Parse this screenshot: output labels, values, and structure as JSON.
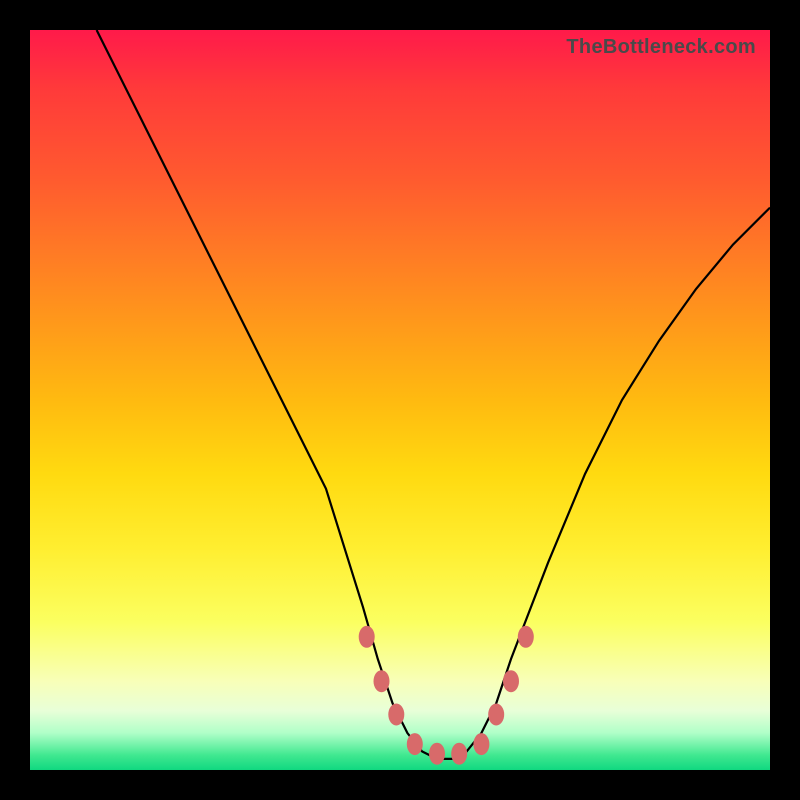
{
  "watermark": "TheBottleneck.com",
  "chart_data": {
    "type": "line",
    "title": "",
    "xlabel": "",
    "ylabel": "",
    "xlim": [
      0,
      100
    ],
    "ylim": [
      0,
      100
    ],
    "grid": false,
    "legend": false,
    "series": [
      {
        "name": "bottleneck-curve",
        "color": "#000000",
        "x": [
          9,
          15,
          20,
          25,
          30,
          35,
          40,
          45,
          47,
          49,
          51,
          53,
          55,
          57,
          59,
          61,
          63,
          65,
          70,
          75,
          80,
          85,
          90,
          95,
          100
        ],
        "y": [
          100,
          88,
          78,
          68,
          58,
          48,
          38,
          22,
          15,
          9,
          5,
          2.5,
          1.5,
          1.5,
          2.5,
          5,
          9,
          15,
          28,
          40,
          50,
          58,
          65,
          71,
          76
        ]
      },
      {
        "name": "marker-dots",
        "type": "scatter",
        "color": "#d86a6a",
        "x": [
          45.5,
          47.5,
          49.5,
          52,
          55,
          58,
          61,
          63,
          65,
          67
        ],
        "y": [
          18,
          12,
          7.5,
          3.5,
          2.2,
          2.2,
          3.5,
          7.5,
          12,
          18
        ]
      }
    ]
  }
}
